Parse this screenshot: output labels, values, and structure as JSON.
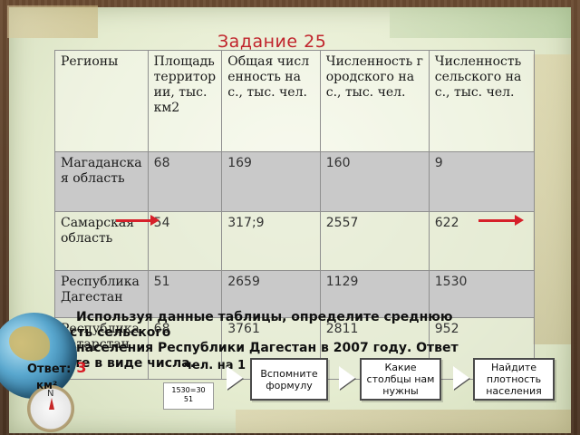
{
  "slide": {
    "title": "Задание 25",
    "accent_color": "#c0232b"
  },
  "table": {
    "headers": [
      "Регионы",
      "Площадь территории, тыс. км2",
      "Общая численность нас., тыс. чел.",
      "Численность городского нас., тыс. чел.",
      "Численность сельского нас., тыс. чел."
    ],
    "rows": [
      [
        "Магаданская область",
        "68",
        "169",
        "160",
        "9"
      ],
      [
        "Самарская область",
        "54",
        "317;9",
        "2557",
        "622"
      ],
      [
        "Республика Дагестан",
        "51",
        "2659",
        "1129",
        "1530"
      ],
      [
        "Республика Татарстан",
        "68",
        "3761",
        "2811",
        "952"
      ]
    ]
  },
  "task": {
    "line1": "Используя данные таблицы, определите среднюю",
    "line2": "плотность сельского",
    "line3": "населения Республики Дагестан в 2007 году. Ответ",
    "line4": "запишите в виде числа."
  },
  "answer": {
    "label": "Ответ:",
    "value": "3",
    "unit_line": "чел. на 1",
    "unit_line2": "км²",
    "calc_top": "1530",
    "calc_bottom": "51",
    "calc_result": "=30"
  },
  "hints": [
    {
      "label": "Вспомните формулу"
    },
    {
      "label": "Какие столбцы нам нужны"
    },
    {
      "label": "Найдите плотность населения"
    }
  ]
}
